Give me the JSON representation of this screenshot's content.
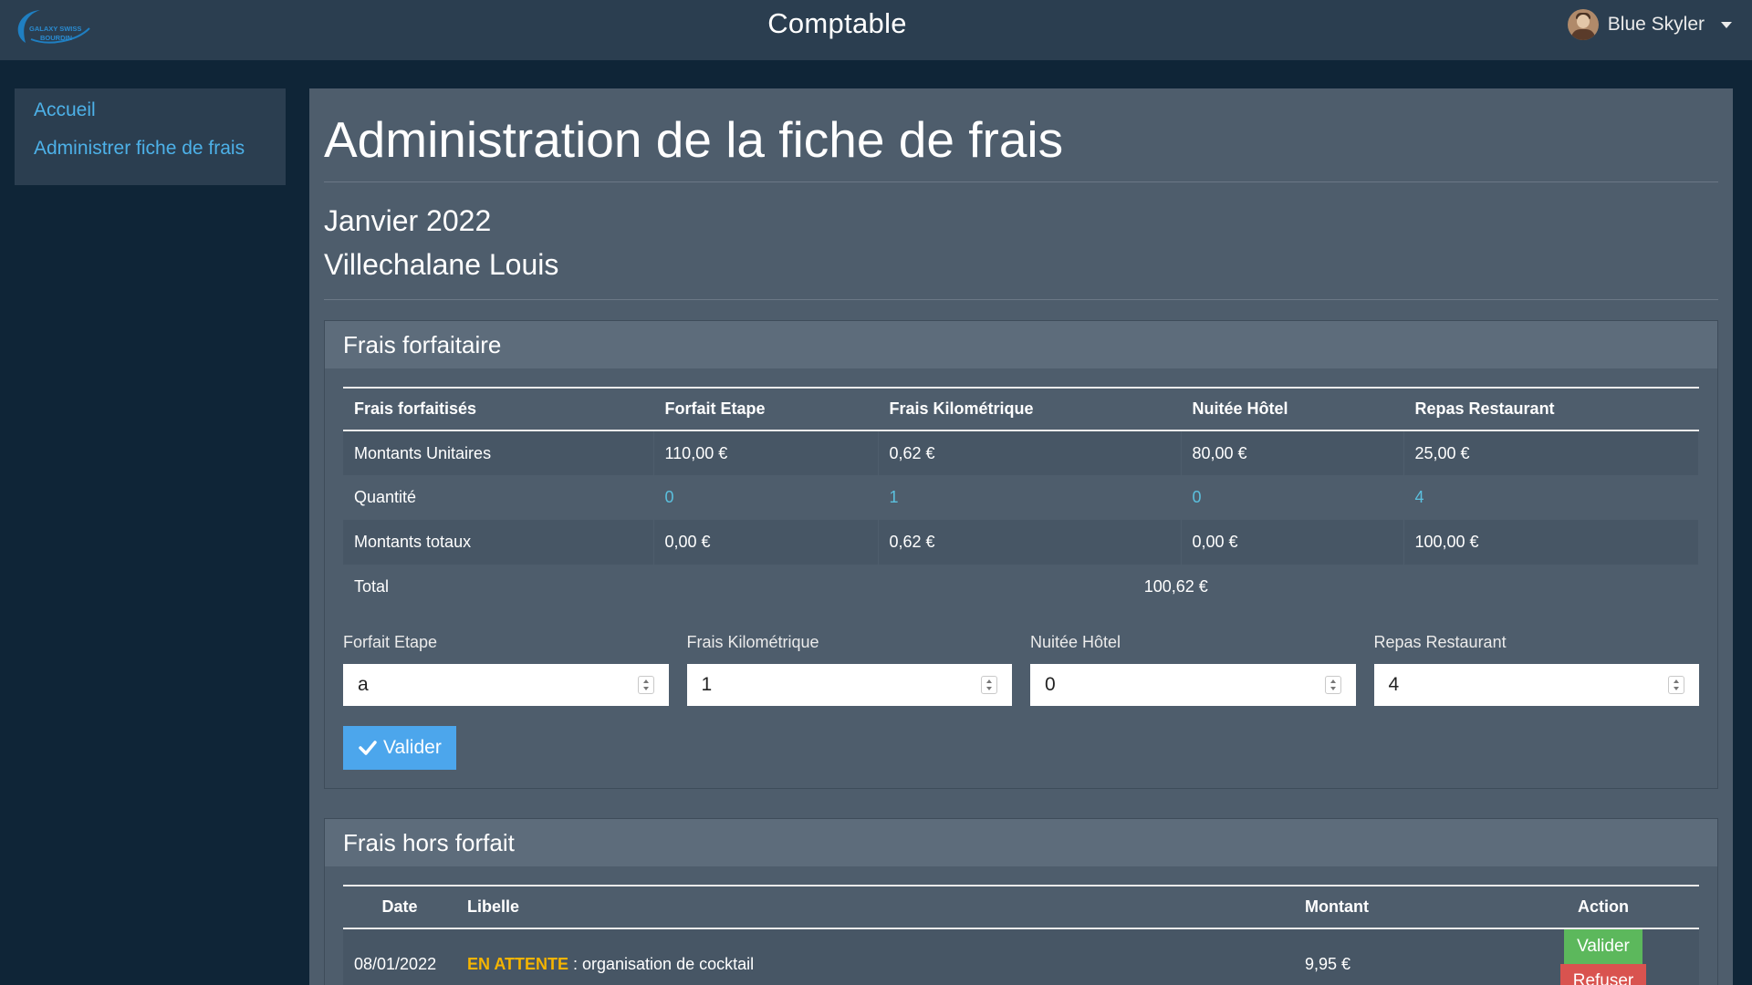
{
  "brand": {
    "logo_line1": "GALAXY SWISS",
    "logo_line2": "BOURDIN"
  },
  "navbar": {
    "title": "Comptable",
    "user_name": "Blue Skyler"
  },
  "sidebar": {
    "items": [
      {
        "label": "Accueil"
      },
      {
        "label": "Administrer fiche de frais"
      }
    ]
  },
  "main": {
    "title": "Administration de la fiche de frais",
    "period": "Janvier 2022",
    "visitor": "Villechalane Louis"
  },
  "forfait": {
    "header": "Frais forfaitaire",
    "columns": [
      "Frais forfaitisés",
      "Forfait Etape",
      "Frais Kilométrique",
      "Nuitée Hôtel",
      "Repas Restaurant"
    ],
    "rows": [
      {
        "label": "Montants Unitaires",
        "values": [
          "110,00 €",
          "0,62 €",
          "80,00 €",
          "25,00 €"
        ]
      },
      {
        "label": "Quantité",
        "values": [
          "0",
          "1",
          "0",
          "4"
        ]
      },
      {
        "label": "Montants totaux",
        "values": [
          "0,00 €",
          "0,62 €",
          "0,00 €",
          "100,00 €"
        ]
      }
    ],
    "total_label": "Total",
    "total_value": "100,62 €",
    "inputs": [
      {
        "label": "Forfait Etape",
        "value": "a"
      },
      {
        "label": "Frais Kilométrique",
        "value": "1"
      },
      {
        "label": "Nuitée Hôtel",
        "value": "0"
      },
      {
        "label": "Repas Restaurant",
        "value": "4"
      }
    ],
    "submit_label": "Valider"
  },
  "hors_forfait": {
    "header": "Frais hors forfait",
    "columns": [
      "Date",
      "Libelle",
      "Montant",
      "Action"
    ],
    "rows": [
      {
        "date": "08/01/2022",
        "status": "EN ATTENTE",
        "libelle": " : organisation de cocktail",
        "montant": "9,95 €",
        "accept_label": "Valider",
        "refuse_label": "Refuser"
      }
    ]
  },
  "colors": {
    "background": "#0f2537",
    "panel": "#4e5d6c",
    "navbar": "#2b3e50",
    "accent": "#4ca6ec",
    "status_pending": "#f5b400",
    "success": "#5cb85c",
    "danger": "#d9534f"
  }
}
